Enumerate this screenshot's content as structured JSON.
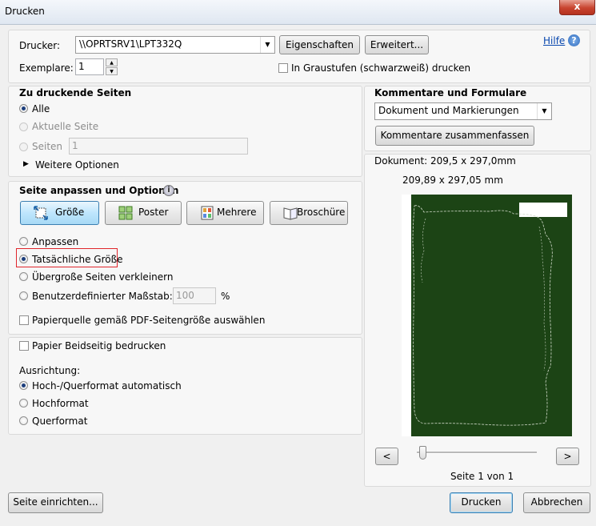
{
  "window": {
    "title": "Drucken",
    "close_glyph": "x"
  },
  "header": {
    "printer_label": "Drucker:",
    "printer_value": "\\\\OPRTSRV1\\LPT332Q",
    "properties_button": "Eigenschaften",
    "advanced_button": "Erweitert...",
    "help_link": "Hilfe",
    "help_icon": "?",
    "copies_label": "Exemplare:",
    "copies_value": "1",
    "grayscale_label": "In Graustufen (schwarzweiß) drucken"
  },
  "pages": {
    "heading": "Zu druckende Seiten",
    "all_label": "Alle",
    "current_label": "Aktuelle Seite",
    "pages_label": "Seiten",
    "pages_value": "1",
    "more_options_label": "Weitere Optionen"
  },
  "sizing": {
    "heading": "Seite anpassen und Optionen",
    "info_icon": "i",
    "tabs": [
      "Größe",
      "Poster",
      "Mehrere",
      "Broschüre"
    ],
    "active_tab": "Größe",
    "fit_label": "Anpassen",
    "actual_label": "Tatsächliche Größe",
    "shrink_label": "Übergroße Seiten verkleinern",
    "custom_label": "Benutzerdefinierter Maßstab:",
    "custom_value": "100",
    "custom_unit": "%",
    "paper_source_label": "Papierquelle gemäß PDF-Seitengröße auswählen"
  },
  "orientation": {
    "duplex_label": "Papier Beidseitig bedrucken",
    "heading": "Ausrichtung:",
    "auto_label": "Hoch-/Querformat automatisch",
    "portrait_label": "Hochformat",
    "landscape_label": "Querformat"
  },
  "comments": {
    "heading": "Kommentare und Formulare",
    "select_value": "Dokument und Markierungen",
    "summarize_button": "Kommentare zusammenfassen"
  },
  "preview": {
    "document_size": "Dokument: 209,5 x 297,0mm",
    "page_size": "209,89 x 297,05 mm",
    "prev_button": "<",
    "next_button": ">",
    "page_indicator": "Seite 1 von 1",
    "slider_position": 0
  },
  "footer": {
    "page_setup_button": "Seite einrichten...",
    "print_button": "Drucken",
    "cancel_button": "Abbrechen"
  },
  "colors": {
    "preview_background": "#1c4415",
    "highlight_border": "#e0262c",
    "link": "#0645ad"
  }
}
